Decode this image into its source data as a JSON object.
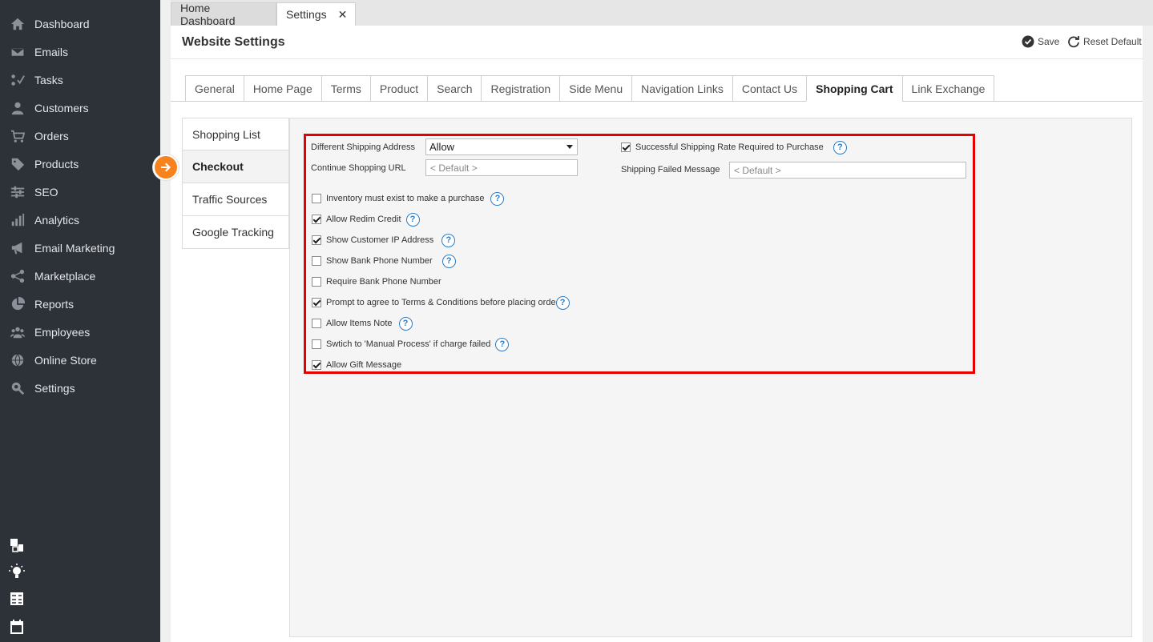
{
  "sidebar": {
    "items": [
      {
        "label": "Dashboard",
        "icon": "home-icon"
      },
      {
        "label": "Emails",
        "icon": "envelope-icon"
      },
      {
        "label": "Tasks",
        "icon": "tasks-icon"
      },
      {
        "label": "Customers",
        "icon": "user-icon"
      },
      {
        "label": "Orders",
        "icon": "cart-icon"
      },
      {
        "label": "Products",
        "icon": "tag-icon"
      },
      {
        "label": "SEO",
        "icon": "sliders-icon"
      },
      {
        "label": "Analytics",
        "icon": "bar-chart-icon"
      },
      {
        "label": "Email Marketing",
        "icon": "megaphone-icon"
      },
      {
        "label": "Marketplace",
        "icon": "share-icon"
      },
      {
        "label": "Reports",
        "icon": "pie-chart-icon"
      },
      {
        "label": "Employees",
        "icon": "group-icon"
      },
      {
        "label": "Online Store",
        "icon": "globe-icon"
      },
      {
        "label": "Settings",
        "icon": "wrench-icon"
      }
    ],
    "bottom_icons": [
      "windows-icon",
      "lightbulb-icon",
      "calculator-icon",
      "calendar-icon"
    ]
  },
  "top_tabs": [
    {
      "label": "Home Dashboard"
    },
    {
      "label": "Settings",
      "close": "✕"
    }
  ],
  "header": {
    "title": "Website Settings",
    "save_label": "Save",
    "reset_label": "Reset Default"
  },
  "settings_tabs": [
    "General",
    "Home Page",
    "Terms",
    "Product",
    "Search",
    "Registration",
    "Side Menu",
    "Navigation Links",
    "Contact Us",
    "Shopping Cart",
    "Link Exchange"
  ],
  "active_settings_tab": "Shopping Cart",
  "submenu": [
    "Shopping List",
    "Checkout",
    "Traffic Sources",
    "Google Tracking"
  ],
  "active_submenu": "Checkout",
  "form": {
    "diff_shipping_label": "Different Shipping Address",
    "diff_shipping_value": "Allow",
    "continue_url_label": "Continue Shopping URL",
    "continue_url_placeholder": "< Default >",
    "success_rate_label": "Successful Shipping Rate Required to Purchase",
    "shipping_failed_label": "Shipping Failed Message",
    "shipping_failed_placeholder": "< Default >",
    "help_glyph": "?",
    "checkboxes": [
      {
        "label": "Inventory must exist to make a purchase",
        "checked": false,
        "help": true
      },
      {
        "label": "Allow Redim Credit",
        "checked": true,
        "help": true
      },
      {
        "label": "Show Customer IP Address",
        "checked": true,
        "help": true
      },
      {
        "label": "Show Bank Phone Number",
        "checked": false,
        "help": true
      },
      {
        "label": "Require Bank Phone Number",
        "checked": false,
        "help": false
      },
      {
        "label": "Prompt to agree to Terms & Conditions before placing orde",
        "checked": true,
        "help": true
      },
      {
        "label": "Allow Items Note",
        "checked": false,
        "help": true
      },
      {
        "label": "Swtich to 'Manual Process' if charge failed",
        "checked": false,
        "help": true
      },
      {
        "label": "Allow Gift Message",
        "checked": true,
        "help": false
      }
    ]
  },
  "colors": {
    "sidebar_bg": "#2d3138",
    "accent_orange": "#f7821e",
    "highlight_red": "#e60000",
    "help_blue": "#2e7bc4"
  }
}
